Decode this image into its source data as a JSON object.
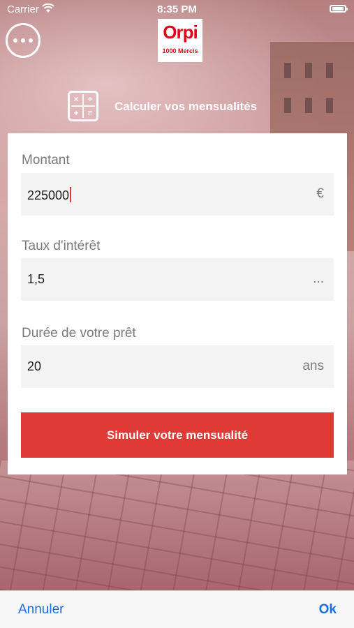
{
  "status_bar": {
    "carrier": "Carrier",
    "time": "8:35 PM"
  },
  "header": {
    "logo_main": "Orpi",
    "logo_sub": "1000 Mercis",
    "section_title": "Calculer vos mensualités",
    "calculator_symbols": [
      "×",
      "÷",
      "+",
      "="
    ]
  },
  "form": {
    "amount": {
      "label": "Montant",
      "value": "225000",
      "unit": "€"
    },
    "rate": {
      "label": "Taux d'intérêt",
      "value": "1,5",
      "unit": "..."
    },
    "duration": {
      "label": "Durée de votre prêt",
      "value": "20",
      "unit": "ans"
    },
    "submit_label": "Simuler votre mensualité"
  },
  "toolbar": {
    "cancel_label": "Annuler",
    "ok_label": "Ok"
  },
  "colors": {
    "accent": "#e03a36",
    "brand": "#e2001a",
    "link": "#1a6fe0"
  },
  "icons": {
    "menu": "more-dots-icon",
    "calculator": "calculator-icon",
    "wifi": "wifi-icon",
    "battery": "battery-icon"
  }
}
